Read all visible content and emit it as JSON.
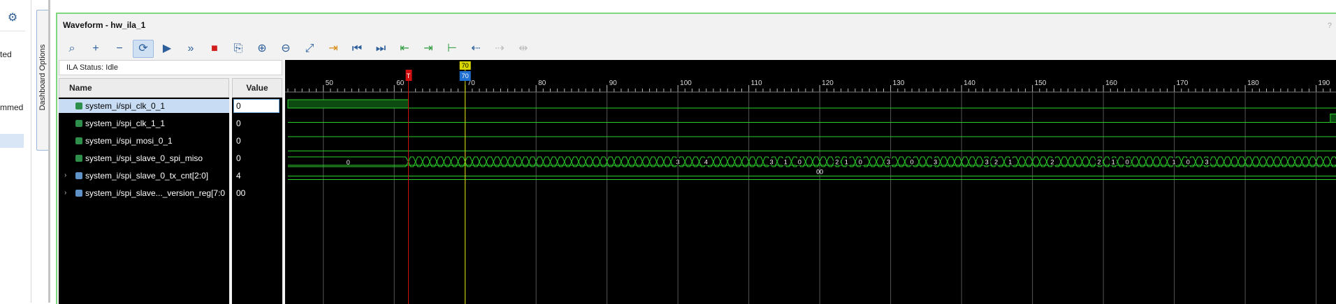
{
  "left_panel": {
    "gear_icon": "gear-icon",
    "text1": "ted",
    "text2": "mmed"
  },
  "dashboard_tab": {
    "label": "Dashboard Options"
  },
  "window": {
    "title": "Waveform - hw_ila_1",
    "help": "?"
  },
  "toolbar": [
    {
      "name": "search",
      "icon": "search-icon",
      "glyph": "⌕"
    },
    {
      "name": "add",
      "icon": "plus-icon",
      "glyph": "+"
    },
    {
      "name": "remove",
      "icon": "minus-icon",
      "glyph": "−"
    },
    {
      "name": "auto-retrigger",
      "icon": "refresh-icon",
      "glyph": "⟳",
      "active": true
    },
    {
      "name": "run-trigger",
      "icon": "play-icon",
      "glyph": "▶"
    },
    {
      "name": "run-immediate",
      "icon": "fast-forward-icon",
      "glyph": "»"
    },
    {
      "name": "stop",
      "icon": "stop-icon",
      "glyph": "■",
      "color": "red"
    },
    {
      "name": "export",
      "icon": "export-icon",
      "glyph": "⎘"
    },
    {
      "name": "zoom-in",
      "icon": "zoom-in-icon",
      "glyph": "⊕"
    },
    {
      "name": "zoom-out",
      "icon": "zoom-out-icon",
      "glyph": "⊖"
    },
    {
      "name": "zoom-fit",
      "icon": "zoom-fit-icon",
      "glyph": "⤢"
    },
    {
      "name": "go-to-cursor",
      "icon": "go-to-cursor-icon",
      "glyph": "⇥",
      "color": "orange"
    },
    {
      "name": "go-to-start",
      "icon": "go-to-start-icon",
      "glyph": "⏮"
    },
    {
      "name": "go-to-end",
      "icon": "go-to-end-icon",
      "glyph": "⏭"
    },
    {
      "name": "previous-transition",
      "icon": "previous-transition-icon",
      "glyph": "⇤",
      "color": "green"
    },
    {
      "name": "next-transition",
      "icon": "next-transition-icon",
      "glyph": "⇥",
      "color": "green"
    },
    {
      "name": "add-marker",
      "icon": "add-marker-icon",
      "glyph": "⊢",
      "color": "green"
    },
    {
      "name": "previous-marker",
      "icon": "previous-marker-icon",
      "glyph": "⇠"
    },
    {
      "name": "next-marker",
      "icon": "next-marker-icon",
      "glyph": "⇢",
      "disabled": true
    },
    {
      "name": "swap-cursors",
      "icon": "swap-cursors-icon",
      "glyph": "⇹",
      "disabled": true
    }
  ],
  "status": {
    "text": "ILA Status: Idle"
  },
  "columns": {
    "name": "Name",
    "value": "Value"
  },
  "signals": [
    {
      "name": "system_i/spi_clk_0_1",
      "value": "0",
      "type": "bit",
      "expandable": false
    },
    {
      "name": "system_i/spi_clk_1_1",
      "value": "0",
      "type": "bit",
      "expandable": false
    },
    {
      "name": "system_i/spi_mosi_0_1",
      "value": "0",
      "type": "bit",
      "expandable": false
    },
    {
      "name": "system_i/spi_slave_0_spi_miso",
      "value": "0",
      "type": "bit",
      "expandable": false
    },
    {
      "name": "system_i/spi_slave_0_tx_cnt[2:0]",
      "value": "4",
      "type": "bus",
      "expandable": true
    },
    {
      "name": "system_i/spi_slave..._version_reg[7:0",
      "value": "00",
      "type": "bus",
      "expandable": true
    }
  ],
  "timeline": {
    "range": [
      45,
      193
    ],
    "major_ticks": [
      50,
      60,
      70,
      80,
      90,
      100,
      110,
      120,
      130,
      140,
      150,
      160,
      170,
      180,
      190
    ],
    "trigger_marker": {
      "position": 62,
      "label": "T",
      "color": "#d01010"
    },
    "cursor": {
      "position": 70,
      "label": "70",
      "color": "#d8d800",
      "label_bg": "#1f6fd0"
    }
  },
  "waveforms": {
    "spi_clk_0_1": {
      "high_until": 62
    },
    "spi_clk_1_1": {
      "rise_at": 192
    },
    "tx_cnt": {
      "initial": "0",
      "change_start": 62,
      "period": 2,
      "labels": [
        "3",
        "4",
        "3",
        "1",
        "0",
        "2",
        "1",
        "0",
        "3",
        "0",
        "3",
        "3",
        "2",
        "1",
        "2",
        "2",
        "1",
        "0",
        "1",
        "0",
        "3"
      ],
      "label_positions": [
        100,
        106,
        120,
        123,
        126,
        134,
        136,
        139,
        145,
        150,
        155,
        166,
        168,
        171,
        180,
        190,
        193,
        196,
        206,
        209,
        213
      ]
    },
    "version_reg": {
      "value": "00"
    }
  }
}
